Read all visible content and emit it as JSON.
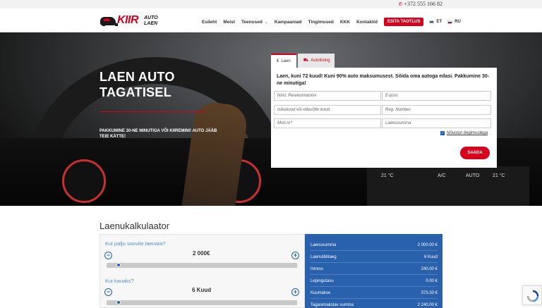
{
  "topbar": {
    "phone": "+372 555 166 82"
  },
  "logo": {
    "brand": "KIIR",
    "sub": "AUTO LAEN"
  },
  "nav": {
    "items": [
      "Esileht",
      "Meist",
      "Teenused",
      "Kampaaniad",
      "Tingimused",
      "KKK",
      "Kontaktid"
    ],
    "apply_label": "ESITA TAOTLUS",
    "lang_et": "ET",
    "lang_ru": "RU"
  },
  "hero": {
    "title": "LAEN AUTO TAGATISEL",
    "subtitle": "PAKKUMINE 30-NE MINUTIGA VÕI KIIREMINI! AUTO JÄÄB TEIE KÄTTE!"
  },
  "form": {
    "tab_loan": "Laen",
    "tab_leasing": "Autoliising",
    "headline": "Laen, kuni 72 kuud! Kuni 90% auto maksumusest. Sõida oma autoga edasi. Pakkumine 30-ne minutiga!",
    "placeholders": {
      "name": "Nimi, Perekonnanimi",
      "email": "E-post",
      "id_code": "Isikukood või ettevõtte kood",
      "reg_number": "Reg. Number",
      "phone": "Mob.nr*",
      "amount": "Laenusumma"
    },
    "agree_label": "Nõustun tingimustega",
    "submit_label": "SAADA"
  },
  "calculator": {
    "title": "Laenukalkulaator",
    "amount_question": "Kui palju soovite laenata?",
    "amount_value": "2 000€",
    "amount_level": 0.03,
    "term_question": "Kui kauaks?",
    "term_value": "6 Kuud",
    "term_level": 0.03,
    "results": [
      {
        "label": "Laenusumma",
        "value": "2 000.00 €"
      },
      {
        "label": "Laenutähtaeg",
        "value": "6 Kuud"
      },
      {
        "label": "Intress",
        "value": "240.00 €"
      },
      {
        "label": "Lepingutasu",
        "value": "0.00 €"
      },
      {
        "label": "Kuumakse",
        "value": "373.33 €"
      },
      {
        "label": "Tagasimakstav summa",
        "value": "2 240.00 €"
      }
    ]
  },
  "hero_screen": {
    "left_temp": "21 °C",
    "right_temp": "21 °C",
    "mode": "A/C",
    "auto": "AUTO"
  },
  "colors": {
    "brand_red": "#d6001c",
    "calc_blue": "#2a61ad",
    "accent_blue": "#1e5fb3"
  }
}
